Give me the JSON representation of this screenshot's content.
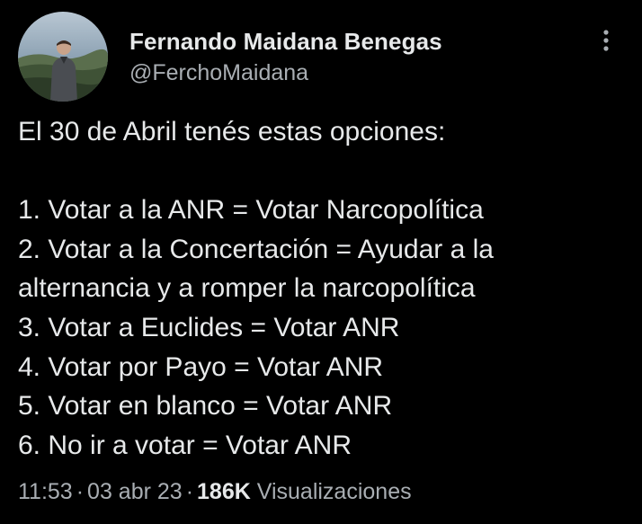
{
  "author": {
    "display_name": "Fernando Maidana Benegas",
    "handle": "@FerchoMaidana",
    "avatar_icon": "profile-photo"
  },
  "more_icon": "more-vertical-icon",
  "tweet": {
    "lines": [
      "El 30 de Abril tenés estas opciones:",
      "",
      "1. Votar a la ANR = Votar Narcopolítica",
      "2. Votar a la Concertación = Ayudar a la",
      "alternancia y a romper la narcopolítica",
      "3. Votar a Euclides = Votar ANR",
      "4. Votar por Payo = Votar ANR",
      "5. Votar en blanco = Votar ANR",
      "6. No ir a votar = Votar ANR"
    ]
  },
  "meta": {
    "time": "11:53",
    "separator": "·",
    "date": "03 abr 23",
    "views_count": "186K",
    "views_label": "Visualizaciones"
  },
  "colors": {
    "background": "#000000",
    "primary_text": "#e7e9ea",
    "secondary_text": "#a9aeb3"
  }
}
